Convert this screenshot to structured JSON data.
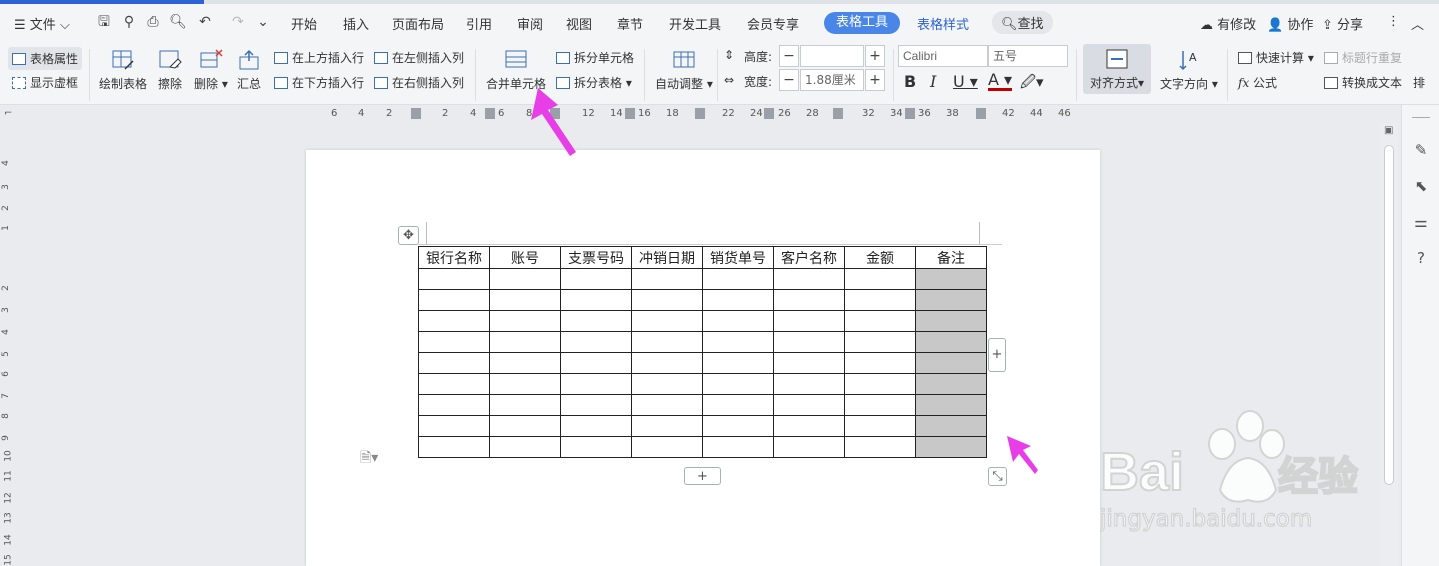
{
  "menu": {
    "file": "文件",
    "tabs": [
      "开始",
      "插入",
      "页面布局",
      "引用",
      "审阅",
      "视图",
      "章节",
      "开发工具",
      "会员专享"
    ],
    "active_tab": "表格工具",
    "style_tab": "表格样式",
    "search": "查找",
    "right": {
      "modified": "有修改",
      "collab": "协作",
      "share": "分享"
    }
  },
  "ribbon": {
    "table_props": "表格属性",
    "show_grid": "显示虚框",
    "draw_table": "绘制表格",
    "erase": "擦除",
    "delete": "删除",
    "summary": "汇总",
    "ins_above": "在上方插入行",
    "ins_below": "在下方插入行",
    "ins_left": "在左侧插入列",
    "ins_right": "在右侧插入列",
    "merge": "合并单元格",
    "split_cell": "拆分单元格",
    "split_table": "拆分表格",
    "auto_fit": "自动调整",
    "height_label": "高度:",
    "height_value": "",
    "width_label": "宽度:",
    "width_value": "1.88厘米",
    "font_name": "Calibri",
    "font_size": "五号",
    "align": "对齐方式",
    "text_dir": "文字方向",
    "quick_calc": "快速计算",
    "formula": "公式",
    "title_repeat": "标题行重复",
    "to_text": "转换成文本",
    "sort": "排"
  },
  "ruler": {
    "h_ticks": [
      "6",
      "4",
      "2",
      "2",
      "4",
      "6",
      "8",
      "12",
      "14",
      "16",
      "18",
      "22",
      "24",
      "26",
      "28",
      "32",
      "34",
      "36",
      "38",
      "42",
      "44",
      "46"
    ],
    "v_ticks": [
      "4",
      "3",
      "2",
      "1",
      "2",
      "3",
      "4",
      "5",
      "6",
      "7",
      "8",
      "9",
      "10",
      "11",
      "12",
      "13",
      "14",
      "15"
    ]
  },
  "table": {
    "headers": [
      "银行名称",
      "账号",
      "支票号码",
      "冲销日期",
      "销货单号",
      "客户名称",
      "金额",
      "备注"
    ],
    "empty_rows": 9
  },
  "watermark": {
    "brand": "Bai",
    "brand2": "经验",
    "url": "jingyan.baidu.com"
  },
  "colors": {
    "accent": "#2c63d6",
    "arrow": "#e83ee8",
    "selected_cell": "#c8c8c8"
  }
}
